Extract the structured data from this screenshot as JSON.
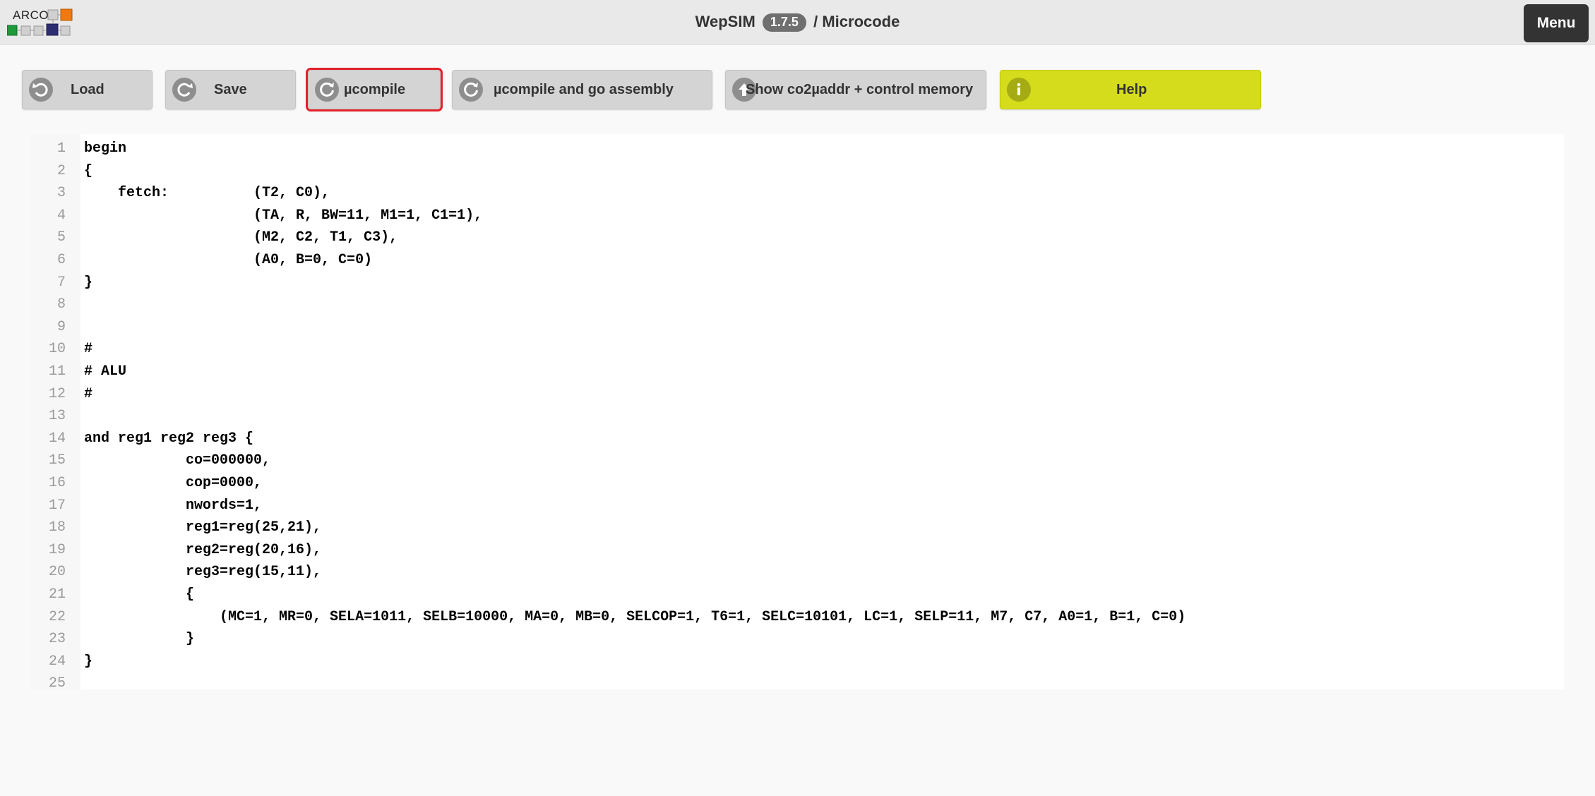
{
  "header": {
    "logo_text": "ARCOS",
    "app_name": "WepSIM",
    "version": "1.7.5",
    "separator": "/",
    "section": "Microcode",
    "menu_label": "Menu"
  },
  "toolbar": {
    "load_label": "Load",
    "save_label": "Save",
    "ucompile_label": "µcompile",
    "ucompile_go_label": "µcompile and go assembly",
    "show_label": "Show co2µaddr + control memory",
    "help_label": "Help",
    "icons": {
      "load": "undo-icon",
      "save": "redo-icon",
      "ucompile": "refresh-icon",
      "ucompile_go": "refresh-icon",
      "show": "upload-icon",
      "help": "info-icon"
    }
  },
  "colors": {
    "selected_outline": "#e3202a",
    "help_button": "#d5dc1c",
    "header_bg": "#e9e9e9"
  },
  "editor": {
    "lines": [
      {
        "n": "1",
        "text": "begin"
      },
      {
        "n": "2",
        "text": "{"
      },
      {
        "n": "3",
        "text": "    fetch:          (T2, C0),"
      },
      {
        "n": "4",
        "text": "                    (TA, R, BW=11, M1=1, C1=1),"
      },
      {
        "n": "5",
        "text": "                    (M2, C2, T1, C3),"
      },
      {
        "n": "6",
        "text": "                    (A0, B=0, C=0)"
      },
      {
        "n": "7",
        "text": "}"
      },
      {
        "n": "8",
        "text": ""
      },
      {
        "n": "9",
        "text": ""
      },
      {
        "n": "10",
        "text": "#"
      },
      {
        "n": "11",
        "text": "# ALU"
      },
      {
        "n": "12",
        "text": "#"
      },
      {
        "n": "13",
        "text": ""
      },
      {
        "n": "14",
        "text": "and reg1 reg2 reg3 {"
      },
      {
        "n": "15",
        "text": "            co=000000,"
      },
      {
        "n": "16",
        "text": "            cop=0000,"
      },
      {
        "n": "17",
        "text": "            nwords=1,"
      },
      {
        "n": "18",
        "text": "            reg1=reg(25,21),"
      },
      {
        "n": "19",
        "text": "            reg2=reg(20,16),"
      },
      {
        "n": "20",
        "text": "            reg3=reg(15,11),"
      },
      {
        "n": "21",
        "text": "            {"
      },
      {
        "n": "22",
        "text": "                (MC=1, MR=0, SELA=1011, SELB=10000, MA=0, MB=0, SELCOP=1, T6=1, SELC=10101, LC=1, SELP=11, M7, C7, A0=1, B=1, C=0)"
      },
      {
        "n": "23",
        "text": "            }"
      },
      {
        "n": "24",
        "text": "}"
      },
      {
        "n": "25",
        "text": ""
      }
    ]
  }
}
